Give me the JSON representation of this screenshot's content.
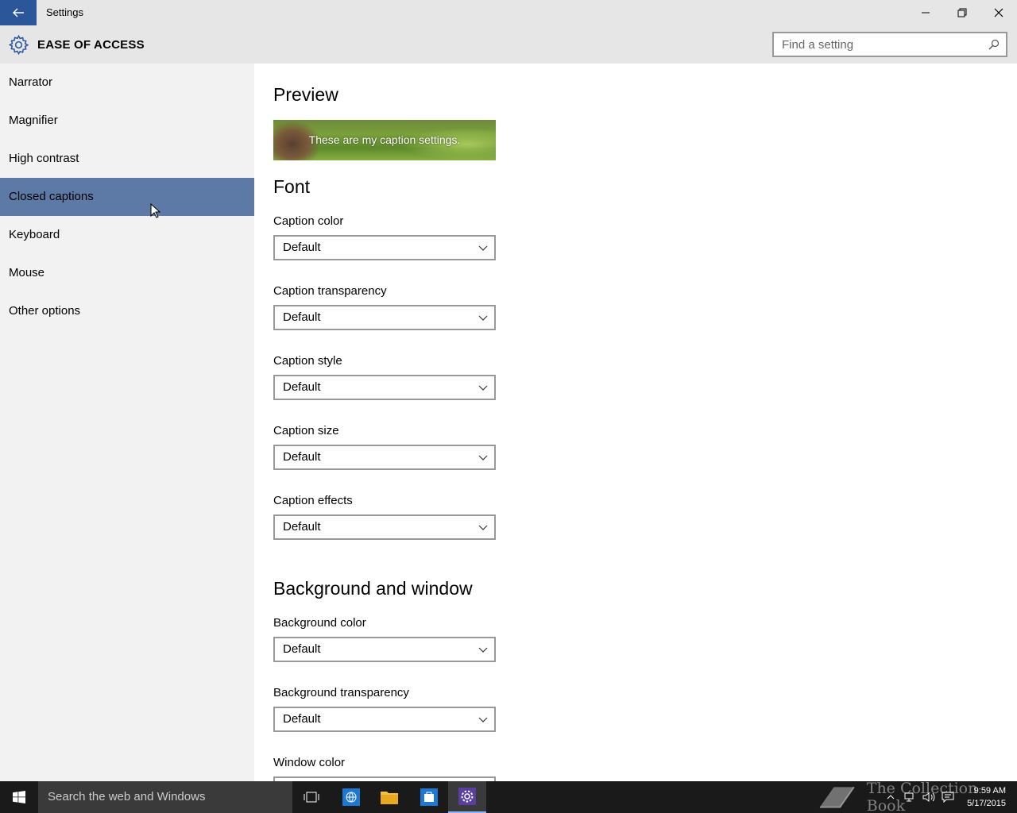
{
  "window": {
    "title": "Settings"
  },
  "header": {
    "section_title": "EASE OF ACCESS",
    "search_placeholder": "Find a setting"
  },
  "sidebar": {
    "items": [
      {
        "label": "Narrator"
      },
      {
        "label": "Magnifier"
      },
      {
        "label": "High contrast"
      },
      {
        "label": "Closed captions",
        "selected": true
      },
      {
        "label": "Keyboard"
      },
      {
        "label": "Mouse"
      },
      {
        "label": "Other options"
      }
    ]
  },
  "main": {
    "preview_heading": "Preview",
    "preview_text": "These are my caption settings.",
    "font_heading": "Font",
    "font_settings": [
      {
        "label": "Caption color",
        "value": "Default"
      },
      {
        "label": "Caption transparency",
        "value": "Default"
      },
      {
        "label": "Caption style",
        "value": "Default"
      },
      {
        "label": "Caption size",
        "value": "Default"
      },
      {
        "label": "Caption effects",
        "value": "Default"
      }
    ],
    "background_heading": "Background and window",
    "background_settings": [
      {
        "label": "Background color",
        "value": "Default"
      },
      {
        "label": "Background transparency",
        "value": "Default"
      },
      {
        "label": "Window color",
        "value": ""
      }
    ]
  },
  "taskbar": {
    "search_text": "Search the web and Windows",
    "watermark": "The Collection Book",
    "time": "9:59 AM",
    "date": "5/17/2015"
  },
  "colors": {
    "accent": "#2b579a",
    "selected_nav": "#5d7aa7",
    "taskbar": "#1a1a1a"
  }
}
